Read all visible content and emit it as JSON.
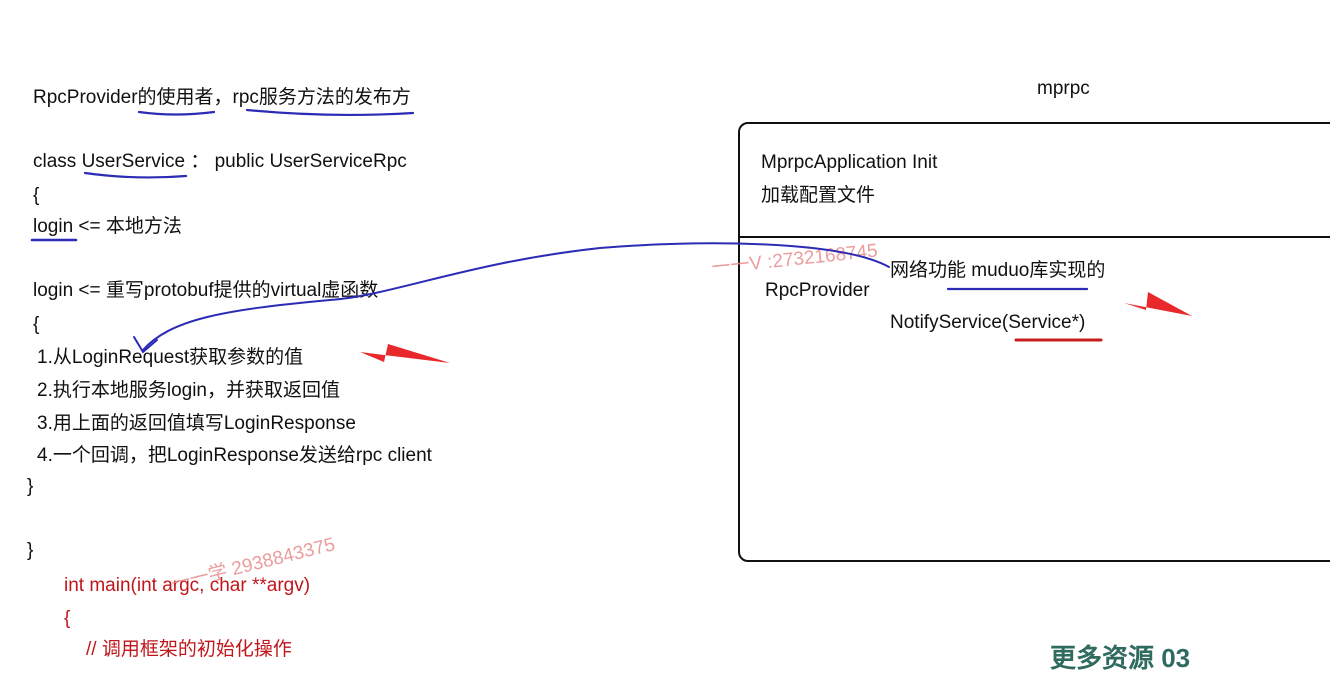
{
  "left_code": {
    "heading": "RpcProvider的使用者，rpc服务方法的发布方",
    "class_decl": "class UserService ：  public UserServiceRpc",
    "open_brace": "{",
    "login_local": "login <= 本地方法",
    "login_override": "login <= 重写protobuf提供的virtual虚函数",
    "inner_open": "{",
    "steps": [
      "1.从LoginRequest获取参数的值",
      "2.执行本地服务login，并获取返回值",
      "3.用上面的返回值填写LoginResponse",
      "4.一个回调，把LoginResponse发送给rpc client"
    ],
    "inner_close": "}",
    "class_close": "}"
  },
  "main_code": {
    "signature": "int main(int argc, char **argv)",
    "open_brace": "{",
    "comment": "// 调用框架的初始化操作"
  },
  "right_diagram": {
    "title": "mprpc",
    "init_line": "MprpcApplication   Init",
    "load_config": "加载配置文件",
    "provider": "RpcProvider",
    "network": "网络功能 muduo库实现的",
    "notify": "NotifyService(Service*)"
  },
  "watermarks": {
    "left": "一一学 2938843375",
    "right": "一一V :2732168745",
    "bottom_right": "更多资源   03"
  },
  "colors": {
    "underline_blue": "#2b2bb5",
    "arrow_red": "#e8282b",
    "code_red": "#c0161b"
  }
}
